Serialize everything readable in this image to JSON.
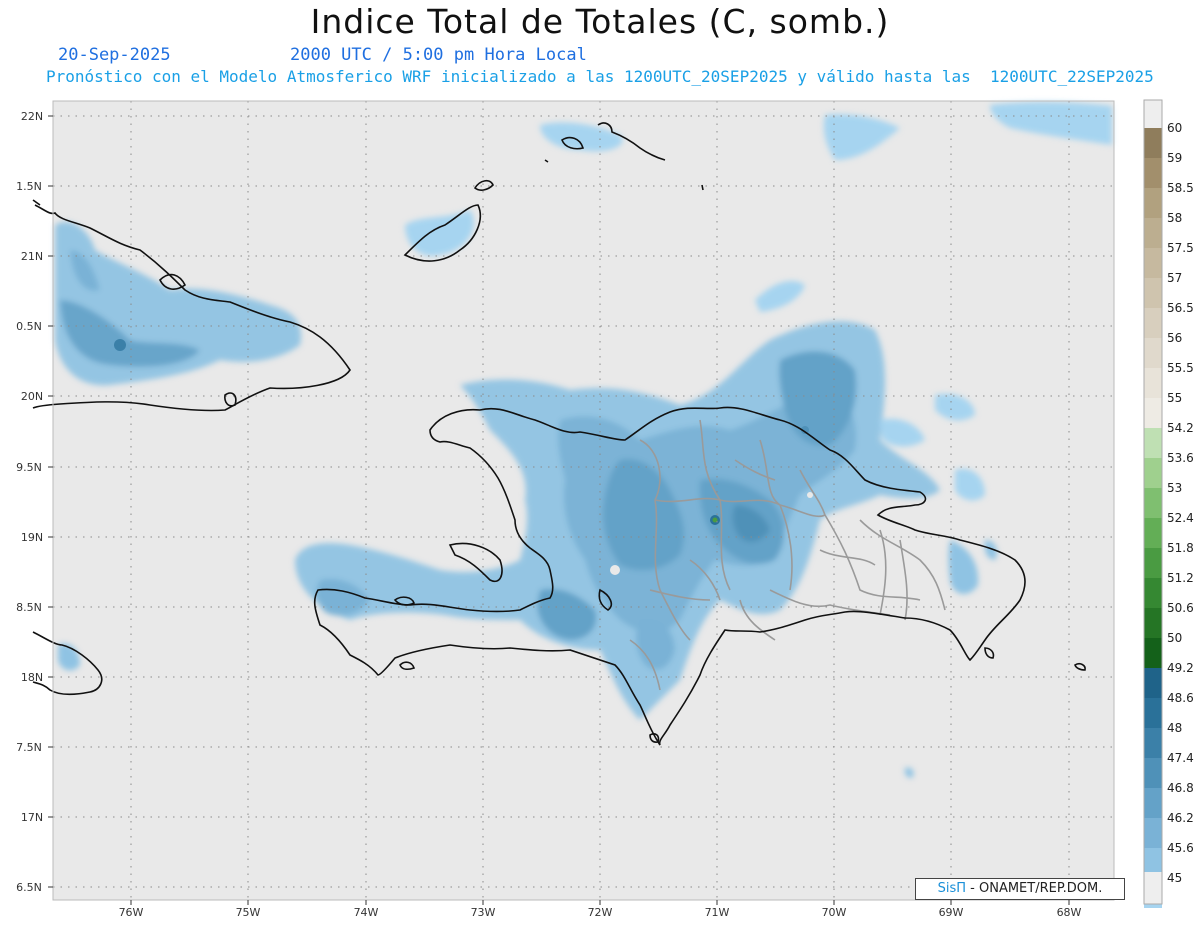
{
  "title": "Indice Total de Totales (C, somb.)",
  "date": "20-Sep-2025",
  "time": "2000 UTC / 5:00 pm Hora Local",
  "forecast_info": "Pronóstico con el Modelo Atmosferico WRF inicializado a las 1200UTC_20SEP2025 y válido hasta las  1200UTC_22SEP2025",
  "credit": {
    "logo": "SisΠ",
    "text": " - ONAMET/REP.DOM."
  },
  "lat_labels": [
    "22N",
    "1.5N",
    "21N",
    "0.5N",
    "20N",
    "9.5N",
    "19N",
    "8.5N",
    "18N",
    "7.5N",
    "17N",
    "6.5N"
  ],
  "lon_labels": [
    "76W",
    "75W",
    "74W",
    "73W",
    "72W",
    "71W",
    "70W",
    "69W",
    "68W"
  ],
  "colorbar": {
    "labels": [
      "60",
      "59",
      "58.5",
      "58",
      "57.5",
      "57",
      "56.5",
      "56",
      "55.5",
      "55",
      "54.2",
      "53.6",
      "53",
      "52.4",
      "51.8",
      "51.2",
      "50.6",
      "50",
      "49.2",
      "48.6",
      "48",
      "47.4",
      "46.8",
      "46.2",
      "45.6",
      "45"
    ],
    "colors": [
      "#8f7d5c",
      "#a28f6c",
      "#b1a17f",
      "#bcae90",
      "#c6b99f",
      "#cfc4ae",
      "#d8cfbe",
      "#e0d9cc",
      "#e8e3d9",
      "#eeebe4",
      "#bfe0b3",
      "#9fd08e",
      "#7fbf70",
      "#63ae56",
      "#4a9b42",
      "#358832",
      "#257525",
      "#14611a",
      "#1f6389",
      "#2a7199",
      "#3b80a8",
      "#4f91b8",
      "#64a2c8",
      "#7ab2d6",
      "#8fc3e3",
      "#a6d4f0"
    ],
    "top_color": "#eeeeee",
    "bottom_color": "#eeeeee"
  }
}
